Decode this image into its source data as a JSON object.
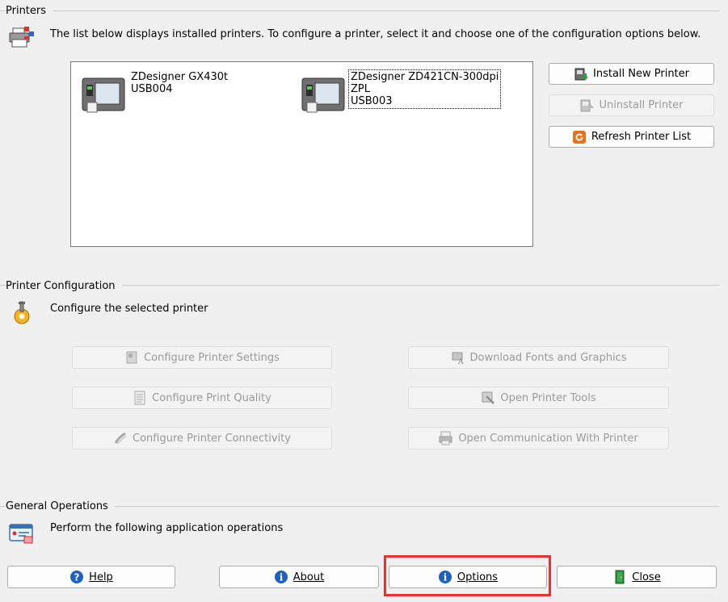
{
  "printers_section": {
    "title": "Printers",
    "description": "The list below displays installed printers. To configure a printer, select it and choose one of the configuration options below.",
    "printers": [
      {
        "name": "ZDesigner GX430t",
        "line2": "USB004",
        "line3": "",
        "selected": false
      },
      {
        "name": "ZDesigner ZD421CN-300dpi",
        "line2": "ZPL",
        "line3": "USB003",
        "selected": true
      }
    ],
    "buttons": {
      "install": "Install New Printer",
      "uninstall": "Uninstall Printer",
      "refresh": "Refresh Printer List"
    }
  },
  "config_section": {
    "title": "Printer Configuration",
    "description": "Configure the selected printer",
    "buttons": {
      "settings": "Configure Printer Settings",
      "fonts": "Download Fonts and Graphics",
      "quality": "Configure Print Quality",
      "tools": "Open Printer Tools",
      "connectivity": "Configure Printer Connectivity",
      "communication": "Open Communication With Printer"
    }
  },
  "general_section": {
    "title": "General Operations",
    "description": "Perform the following application operations",
    "buttons": {
      "help": "Help",
      "about": "About",
      "options": "Options",
      "close": "Close"
    }
  },
  "colors": {
    "highlight": "#e3342f",
    "info_icon": "#1f5fbf",
    "close_icon": "#2e8b3a",
    "refresh_icon": "#e8731d"
  }
}
